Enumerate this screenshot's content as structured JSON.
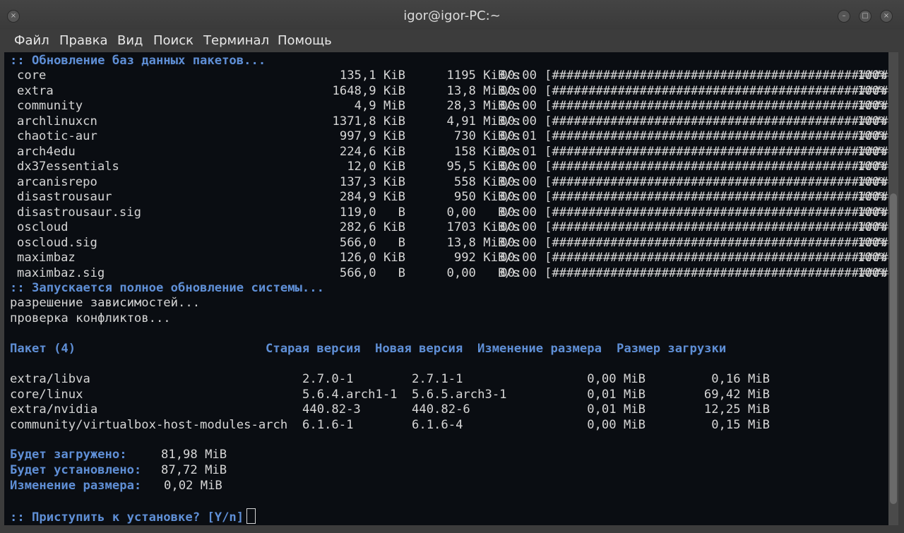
{
  "window": {
    "title": "igor@igor-PC:~"
  },
  "menu": [
    "Файл",
    "Правка",
    "Вид",
    "Поиск",
    "Терминал",
    "Помощь"
  ],
  "terminal": {
    "sync_header": ":: Обновление баз данных пакетов...",
    "repos": [
      {
        "name": "core",
        "size": "135,1 KiB",
        "speed": "1195 KiB/s",
        "time": "00:00",
        "bar": "[########################################################]",
        "percent": "100%"
      },
      {
        "name": "extra",
        "size": "1648,9 KiB",
        "speed": "13,8 MiB/s",
        "time": "00:00",
        "bar": "[########################################################]",
        "percent": "100%"
      },
      {
        "name": "community",
        "size": "4,9 MiB",
        "speed": "28,3 MiB/s",
        "time": "00:00",
        "bar": "[########################################################]",
        "percent": "100%"
      },
      {
        "name": "archlinuxcn",
        "size": "1371,8 KiB",
        "speed": "4,91 MiB/s",
        "time": "00:00",
        "bar": "[########################################################]",
        "percent": "100%"
      },
      {
        "name": "chaotic-aur",
        "size": "997,9 KiB",
        "speed": "730 KiB/s",
        "time": "00:01",
        "bar": "[########################################################]",
        "percent": "100%"
      },
      {
        "name": "arch4edu",
        "size": "224,6 KiB",
        "speed": "158 KiB/s",
        "time": "00:01",
        "bar": "[########################################################]",
        "percent": "100%"
      },
      {
        "name": "dx37essentials",
        "size": "12,0 KiB",
        "speed": "95,5 KiB/s",
        "time": "00:00",
        "bar": "[########################################################]",
        "percent": "100%"
      },
      {
        "name": "arcanisrepo",
        "size": "137,3 KiB",
        "speed": "558 KiB/s",
        "time": "00:00",
        "bar": "[########################################################]",
        "percent": "100%"
      },
      {
        "name": "disastrousaur",
        "size": "284,9 KiB",
        "speed": "950 KiB/s",
        "time": "00:00",
        "bar": "[########################################################]",
        "percent": "100%"
      },
      {
        "name": "disastrousaur.sig",
        "size": "119,0   B",
        "speed": "0,00   B/s",
        "time": "00:00",
        "bar": "[########################################################]",
        "percent": "100%"
      },
      {
        "name": "oscloud",
        "size": "282,6 KiB",
        "speed": "1703 KiB/s",
        "time": "00:00",
        "bar": "[########################################################]",
        "percent": "100%"
      },
      {
        "name": "oscloud.sig",
        "size": "566,0   B",
        "speed": "13,8 MiB/s",
        "time": "00:00",
        "bar": "[########################################################]",
        "percent": "100%"
      },
      {
        "name": "maximbaz",
        "size": "126,0 KiB",
        "speed": "992 KiB/s",
        "time": "00:00",
        "bar": "[########################################################]",
        "percent": "100%"
      },
      {
        "name": "maximbaz.sig",
        "size": "566,0   B",
        "speed": "0,00   B/s",
        "time": "00:00",
        "bar": "[########################################################]",
        "percent": "100%"
      }
    ],
    "upgrade_header": ":: Запускается полное обновление системы...",
    "resolving": "разрешение зависимостей...",
    "checking": "проверка конфликтов...",
    "table_headers": {
      "package": "Пакет (4)",
      "old_version": "Старая версия",
      "new_version": "Новая версия",
      "size_change": "Изменение размера",
      "download_size": "Размер загрузки"
    },
    "packages": [
      {
        "name": "extra/libva",
        "old": "2.7.0-1",
        "new": "2.7.1-1",
        "change": "0,00 MiB",
        "download": "0,16 MiB"
      },
      {
        "name": "core/linux",
        "old": "5.6.4.arch1-1",
        "new": "5.6.5.arch3-1",
        "change": "0,01 MiB",
        "download": "69,42 MiB"
      },
      {
        "name": "extra/nvidia",
        "old": "440.82-3",
        "new": "440.82-6",
        "change": "0,01 MiB",
        "download": "12,25 MiB"
      },
      {
        "name": "community/virtualbox-host-modules-arch",
        "old": "6.1.6-1",
        "new": "6.1.6-4",
        "change": "0,00 MiB",
        "download": "0,15 MiB"
      }
    ],
    "summary": [
      {
        "label": "Будет загружено:",
        "value": "81,98 MiB"
      },
      {
        "label": "Будет установлено:",
        "value": "87,72 MiB"
      },
      {
        "label": "Изменение размера:",
        "value": "0,02 MiB"
      }
    ],
    "prompt": ":: Приступить к установке? [Y/n]"
  },
  "colors": {
    "terminal_bg": "#0a0d12",
    "text": "#d6d6d6",
    "accent_blue": "#5f8fd6"
  }
}
